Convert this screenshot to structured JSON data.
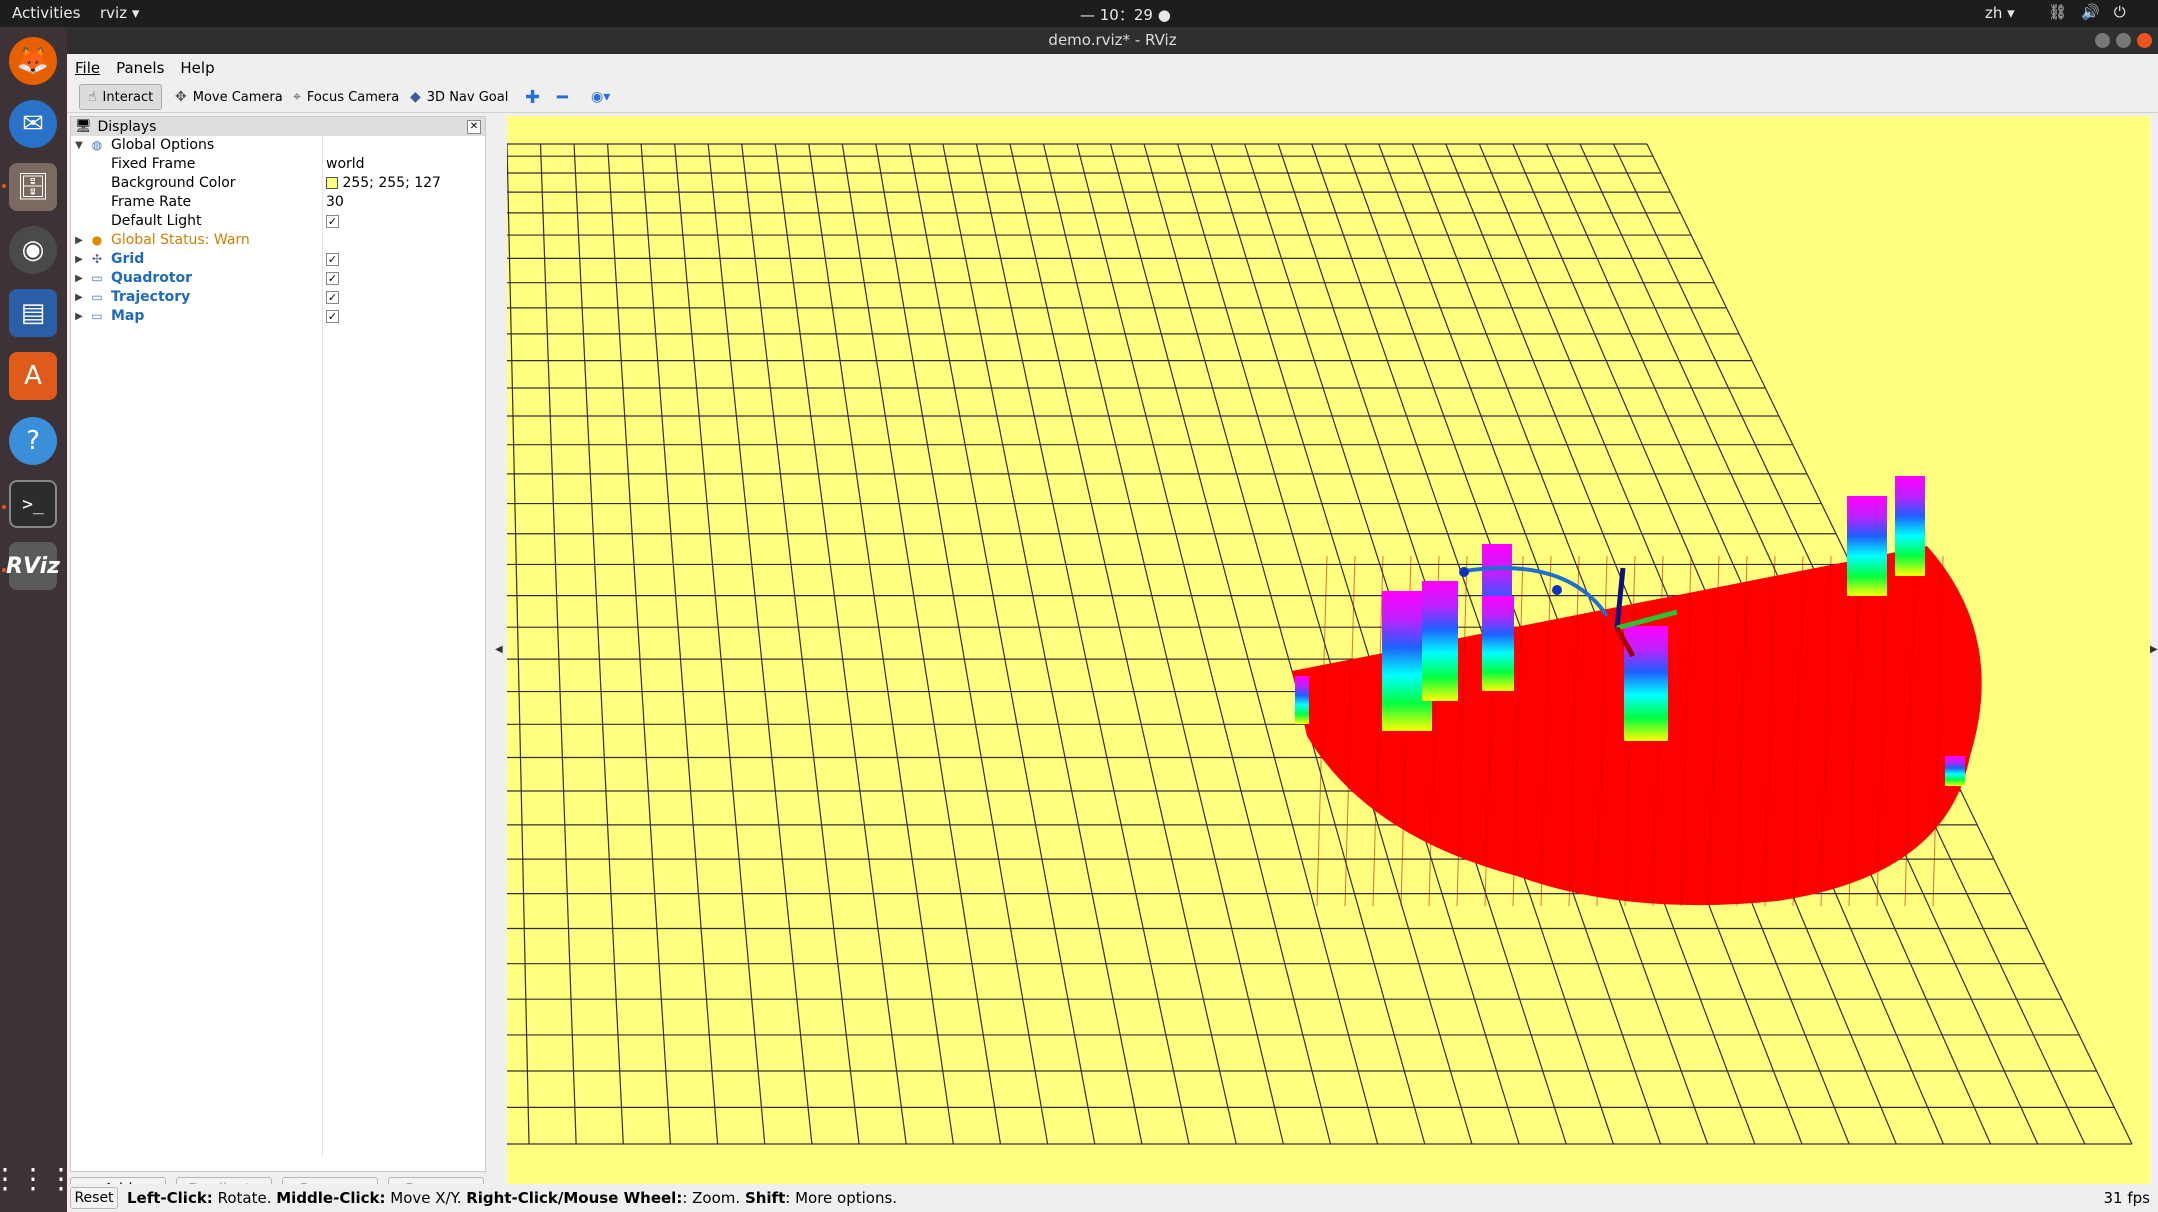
{
  "topbar": {
    "activities": "Activities",
    "app_menu": "rviz ▾",
    "clock": "— 10：29 ●",
    "lang": "zh ▾"
  },
  "window": {
    "title": "demo.rviz* - RViz"
  },
  "menu": {
    "file": "File",
    "panels": "Panels",
    "help": "Help"
  },
  "toolbar": {
    "interact": "Interact",
    "move_camera": "Move Camera",
    "focus_camera": "Focus Camera",
    "nav_goal": "3D Nav Goal"
  },
  "displays": {
    "title": "Displays",
    "global_options": {
      "label": "Global Options",
      "fixed_frame_label": "Fixed Frame",
      "fixed_frame_value": "world",
      "bg_color_label": "Background Color",
      "bg_color_value": "255; 255; 127",
      "bg_color_hex": "#ffff7f",
      "frame_rate_label": "Frame Rate",
      "frame_rate_value": "30",
      "default_light_label": "Default Light"
    },
    "global_status": "Global Status: Warn",
    "items": [
      {
        "label": "Grid"
      },
      {
        "label": "Quadrotor"
      },
      {
        "label": "Trajectory"
      },
      {
        "label": "Map"
      }
    ]
  },
  "panel_buttons": {
    "add": "Add",
    "duplicate": "Duplicate",
    "remove": "Remove",
    "rename": "Rename"
  },
  "status": {
    "reset": "Reset",
    "help_b1": "Left-Click:",
    "help_t1": " Rotate. ",
    "help_b2": "Middle-Click:",
    "help_t2": " Move X/Y. ",
    "help_b3": "Right-Click/Mouse Wheel:",
    "help_t3": ": Zoom. ",
    "help_b4": "Shift",
    "help_t4": ": More options.",
    "fps": "31 fps"
  }
}
